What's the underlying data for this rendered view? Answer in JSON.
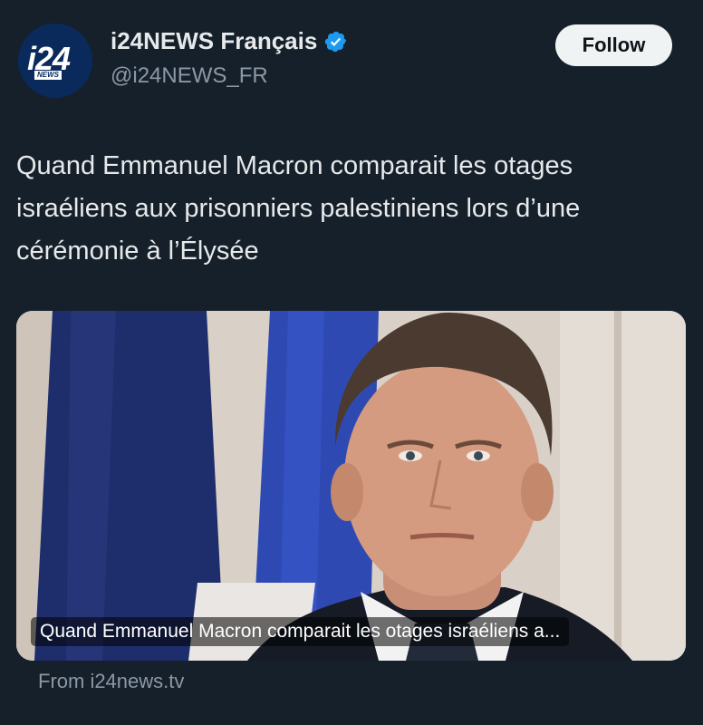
{
  "author": {
    "avatar_logo_text": "i24",
    "avatar_logo_sub": "NEWS",
    "display_name": "i24NEWS Français",
    "handle": "@i24NEWS_FR",
    "verified": true
  },
  "follow_button": {
    "label": "Follow"
  },
  "tweet": {
    "text": "Quand Emmanuel Macron comparait les otages israéliens aux prisonniers palestiniens lors d’une cérémonie à l’Élysée"
  },
  "link_card": {
    "caption": "Quand Emmanuel Macron comparait les otages israéliens a...",
    "source": "From i24news.tv"
  },
  "colors": {
    "background": "#15202b",
    "text": "#e7e9ea",
    "secondary_text": "#8b98a5",
    "verified": "#1d9bf0",
    "follow_bg": "#eff3f4"
  }
}
